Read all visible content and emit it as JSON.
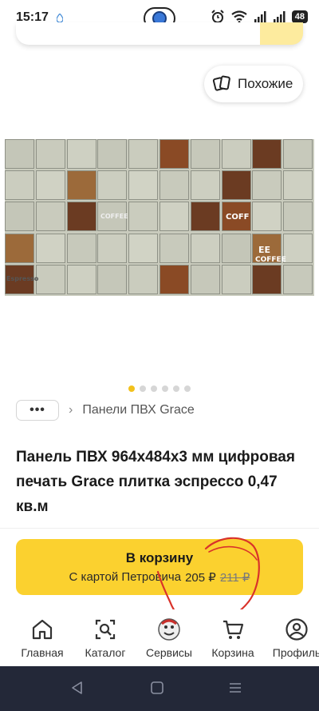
{
  "status_bar": {
    "time": "15:17",
    "battery": "48"
  },
  "similar_button": {
    "label": "Похожие",
    "icon": "cards-icon"
  },
  "gallery": {
    "total_slides": 6,
    "active_index": 0,
    "tile_text_coffee": "COFFEE",
    "tile_text_espresso": "Espresso",
    "tile_text_cof": "COFF",
    "tile_text_ee": "EE"
  },
  "breadcrumb": {
    "more_label": "•••",
    "chevron": "›",
    "category": "Панели ПВХ Grace"
  },
  "product": {
    "title": "Панель ПВХ 964х484х3 мм цифровая печать Grace плитка эспрессо 0,47 кв.м"
  },
  "cart_button": {
    "label": "В корзину",
    "card_text": "С картой Петровича",
    "price": "205 ₽",
    "old_price": "211 ₽"
  },
  "annotation": {
    "color": "#d9322a",
    "shape": "hand-drawn circle around price"
  },
  "colors": {
    "accent": "#fbd12f",
    "active_dot": "#f2c11c",
    "system_nav": "#232838"
  },
  "bottom_nav": {
    "items": [
      {
        "label": "Главная",
        "icon": "home-icon"
      },
      {
        "label": "Каталог",
        "icon": "catalog-search-icon"
      },
      {
        "label": "Сервисы",
        "icon": "services-mascot-icon"
      },
      {
        "label": "Корзина",
        "icon": "cart-icon"
      },
      {
        "label": "Профиль",
        "icon": "profile-icon"
      }
    ]
  }
}
